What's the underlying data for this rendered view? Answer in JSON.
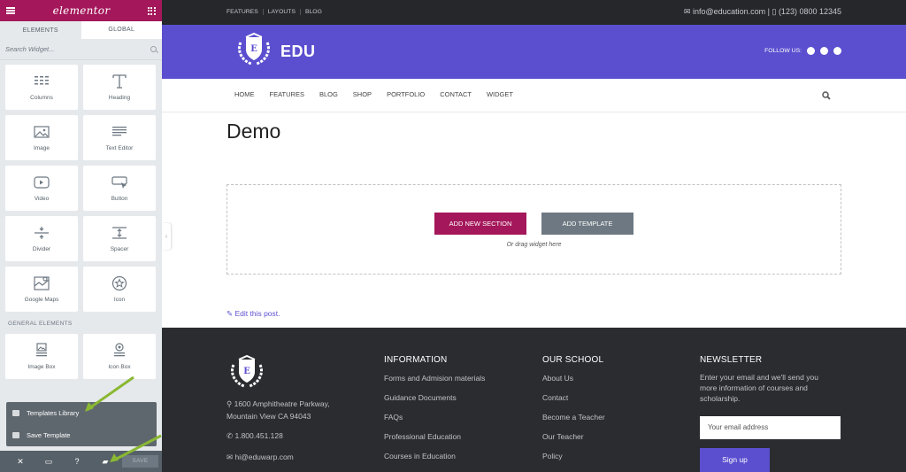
{
  "panel": {
    "brand": "elementor",
    "tabs": [
      "ELEMENTS",
      "GLOBAL"
    ],
    "search_placeholder": "Search Widget...",
    "widgets": [
      "Columns",
      "Heading",
      "Image",
      "Text Editor",
      "Video",
      "Button",
      "Divider",
      "Spacer",
      "Google Maps",
      "Icon"
    ],
    "section_title": "GENERAL ELEMENTS",
    "general_widgets": [
      "Image Box",
      "Icon Box"
    ],
    "templates_menu": [
      "Templates Library",
      "Save Template"
    ],
    "footer": {
      "save_label": "SAVE"
    }
  },
  "site": {
    "topnav": [
      "FEATURES",
      "LAYOUTS",
      "BLOG"
    ],
    "contact": "✉ info@education.com | ▯ (123) 0800 12345",
    "brand_name": "EDU",
    "follow_label": "FOLLOW US:",
    "menu": [
      "HOME",
      "FEATURES",
      "BLOG",
      "SHOP",
      "PORTFOLIO",
      "CONTACT",
      "WIDGET"
    ],
    "page_title": "Demo",
    "add_section_label": "ADD NEW SECTION",
    "add_template_label": "ADD TEMPLATE",
    "drag_hint": "Or drag widget here",
    "edit_link": "Edit this post."
  },
  "footer": {
    "address": "1600 Amphitheatre Parkway, Mountain View CA 94043",
    "phone": "1.800.451.128",
    "email": "hi@eduwarp.com",
    "columns": [
      {
        "heading": "INFORMATION",
        "links": [
          "Forms and Admision materials",
          "Guidance Documents",
          "FAQs",
          "Professional Education",
          "Courses in Education"
        ]
      },
      {
        "heading": "OUR SCHOOL",
        "links": [
          "About Us",
          "Contact",
          "Become a Teacher",
          "Our Teacher",
          "Policy"
        ]
      }
    ],
    "newsletter": {
      "heading": "NEWSLETTER",
      "text": "Enter your email and we'll send you more information of courses and scholarship.",
      "placeholder": "Your email address",
      "button": "Sign up"
    }
  },
  "colors": {
    "accent": "#a4175a",
    "brand": "#5b4fcf",
    "panel": "#e6e9ec",
    "footer": "#2b2c30"
  }
}
